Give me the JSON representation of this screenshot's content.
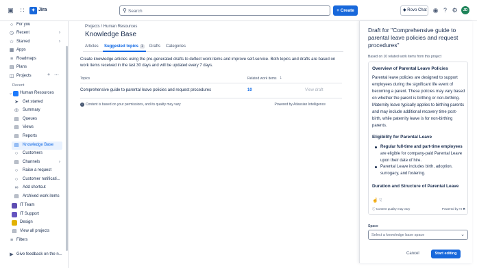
{
  "topbar": {
    "app_name": "Jira",
    "search_placeholder": "Search",
    "create_label": "Create",
    "rovo_label": "Rovo Chat",
    "avatar_initials": "JD"
  },
  "sidebar": {
    "items": [
      {
        "label": "For you",
        "icon": "person-icon"
      },
      {
        "label": "Recent",
        "icon": "clock-icon"
      },
      {
        "label": "Starred",
        "icon": "star-icon"
      },
      {
        "label": "Apps",
        "icon": "apps-icon"
      },
      {
        "label": "Roadmaps",
        "icon": "roadmap-icon"
      },
      {
        "label": "Plans",
        "icon": "plans-icon"
      },
      {
        "label": "Projects",
        "icon": "projects-icon"
      }
    ],
    "recent_label": "Recent",
    "project_name": "Human Resources",
    "project_items": [
      {
        "label": "Get started"
      },
      {
        "label": "Summary"
      },
      {
        "label": "Queues"
      },
      {
        "label": "Views"
      },
      {
        "label": "Reports"
      },
      {
        "label": "Knowledge Base"
      },
      {
        "label": "Customers"
      },
      {
        "label": "Channels"
      },
      {
        "label": "Raise a request"
      },
      {
        "label": "Customer notificati..."
      },
      {
        "label": "Add shortcut"
      },
      {
        "label": "Archived work items"
      }
    ],
    "other_projects": [
      {
        "label": "IT Team",
        "color": "#5e4db2"
      },
      {
        "label": "IT Support",
        "color": "#6554c0"
      },
      {
        "label": "Design",
        "color": "#e2b203"
      }
    ],
    "view_all": "View all projects",
    "filters": "Filters",
    "feedback": "Give feedback on the n..."
  },
  "main": {
    "breadcrumb": [
      "Projects",
      "/",
      "Human Resources"
    ],
    "title": "Knowledge Base",
    "tabs": [
      {
        "label": "Articles"
      },
      {
        "label": "Suggested topics",
        "badge": "1"
      },
      {
        "label": "Drafts"
      },
      {
        "label": "Categories"
      }
    ],
    "description": "Create knowledge articles using the pre-generated drafts to deflect work items and improve self-service. Both topics and drafts are based on work items received in the last 30 days and will be updated every 7 days.",
    "table": {
      "headers": [
        "Topics",
        "Related work items"
      ],
      "rows": [
        {
          "topic": "Comprehensive guide to parental leave policies and request procedures",
          "count": "10",
          "action": "View draft"
        }
      ]
    },
    "footnote": "Content is based on your permissions, and its quality may vary",
    "powered_by": "Powered by Atlassian Intelligence"
  },
  "panel": {
    "title": "Draft for \"Comprehensive guide to parental leave policies and request procedures\"",
    "subtitle": "Based on 10 related work items from this project",
    "draft": {
      "h1": "Overview of Parental Leave Policies",
      "p1": "Parental leave policies are designed to support employees during the significant life event of becoming a parent. These policies may vary based on whether the parent is birthing or non-birthing. Maternity leave typically applies to birthing parents and may include additional recovery time post-birth, while paternity leave is for non-birthing parents.",
      "h2": "Eligibility for Parental Leave",
      "li1_bold": "Regular full-time and part-time employees",
      "li1_rest": " are eligible for company-paid Parental Leave upon their date of hire.",
      "li2": "Parental Leave includes birth, adoption, surrogacy, and fostering.",
      "h3": "Duration and Structure of Parental Leave"
    },
    "content_quality": "Content quality may vary",
    "powered_ai": "Powered by AI",
    "space_label": "Space",
    "space_placeholder": "Select a knowledge base space",
    "cancel": "Cancel",
    "start": "Start editing"
  }
}
